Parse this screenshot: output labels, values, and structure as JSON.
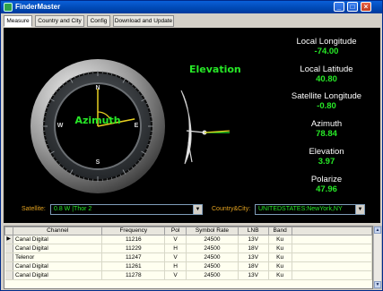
{
  "app": {
    "title": "FinderMaster",
    "minimize": "_",
    "maximize": "□",
    "close": "×"
  },
  "tabs": [
    {
      "label": "Measure",
      "active": true
    },
    {
      "label": "Country and City",
      "active": false
    },
    {
      "label": "Config",
      "active": false
    },
    {
      "label": "Download and Update",
      "active": false
    }
  ],
  "azimuth_dial": {
    "label": "Azimuth",
    "north": "N",
    "south": "S",
    "east": "E",
    "west": "W",
    "azimuth_degrees": 78.84
  },
  "elevation_gauge": {
    "label": "Elevation",
    "elevation_degrees": 3.97
  },
  "readouts": {
    "local_longitude": {
      "label": "Local Longitude",
      "value": "-74.00"
    },
    "local_latitude": {
      "label": "Local Latitude",
      "value": "40.80"
    },
    "satellite_longitude": {
      "label": "Satellite Longitude",
      "value": "-0.80"
    },
    "azimuth": {
      "label": "Azimuth",
      "value": "78.84"
    },
    "elevation": {
      "label": "Elevation",
      "value": "3.97"
    },
    "polarize": {
      "label": "Polarize",
      "value": "47.96"
    }
  },
  "selectors": {
    "satellite_label": "Satellite:",
    "satellite_value": "0.8 W   |Thor 2",
    "country_label": "Country&City:",
    "country_value": "UNITEDSTATES:NewYork,NY"
  },
  "table": {
    "columns": [
      "Channel",
      "Frequency",
      "Pol",
      "Symbol Rate",
      "LNB",
      "Band"
    ],
    "current_row_marker": "▶",
    "rows": [
      [
        "Canal Digital",
        "11216",
        "V",
        "24500",
        "13V",
        "Ku"
      ],
      [
        "Canal Digital",
        "11229",
        "H",
        "24500",
        "18V",
        "Ku"
      ],
      [
        "Telenor",
        "11247",
        "V",
        "24500",
        "13V",
        "Ku"
      ],
      [
        "Canal Digital",
        "11261",
        "H",
        "24500",
        "18V",
        "Ku"
      ],
      [
        "Canal Digital",
        "11278",
        "V",
        "24500",
        "13V",
        "Ku"
      ]
    ]
  },
  "scrollbar": {
    "up": "▲",
    "down": "▼"
  },
  "colors": {
    "readout_value": "#27e827",
    "gauge_label": "#27e827",
    "selector_label": "#e0a020"
  }
}
